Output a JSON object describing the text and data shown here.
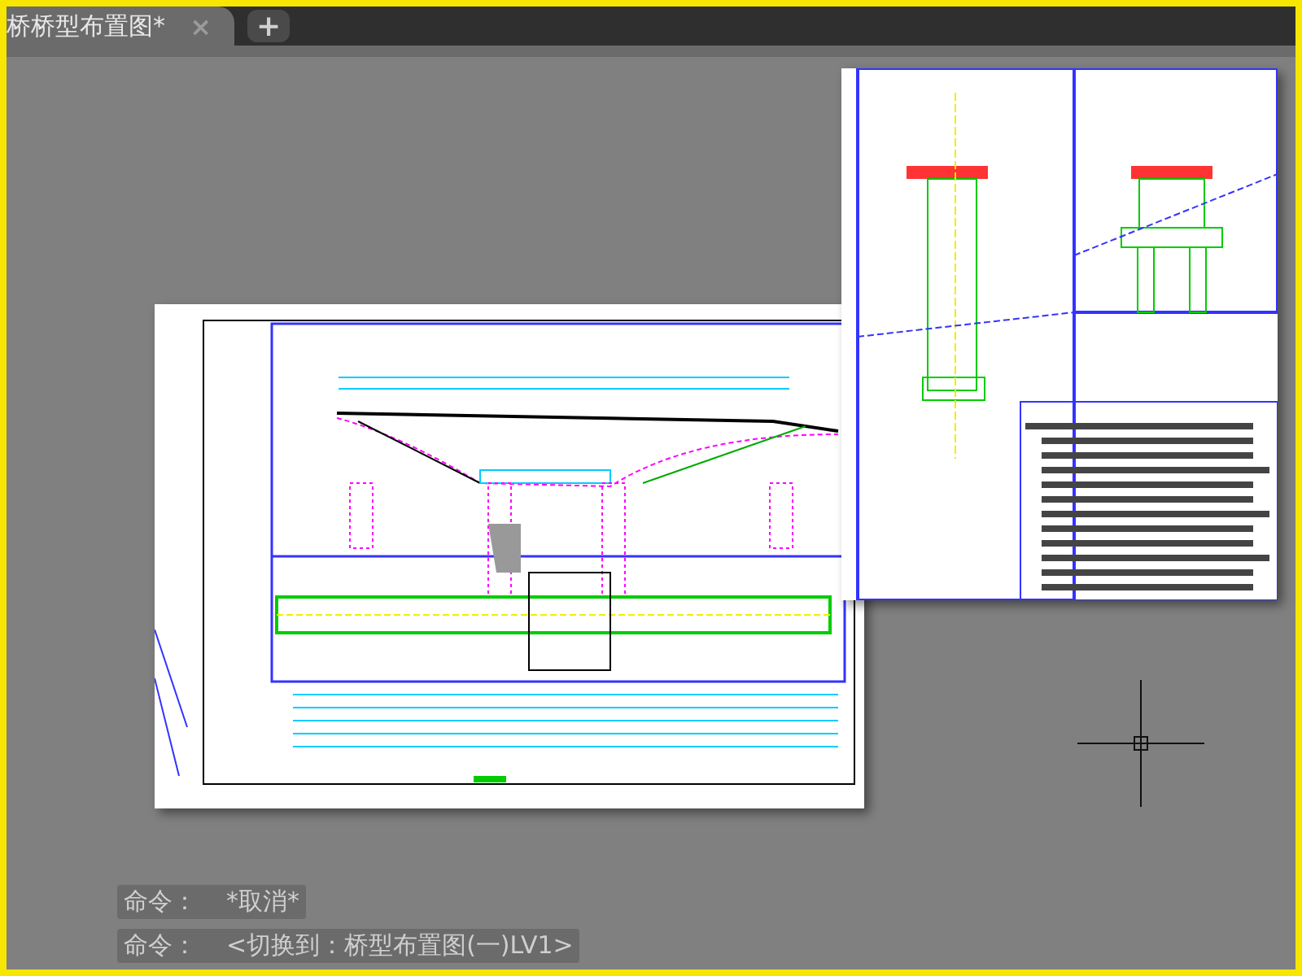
{
  "tabs": [
    {
      "label": "桥桥型布置图*",
      "selected": true,
      "close": "×"
    }
  ],
  "new_tab": "+",
  "command_lines": [
    {
      "prompt": "命令：",
      "message": "*取消*"
    },
    {
      "prompt": "命令：",
      "message": "<切换到：桥型布置图(一)LV1>"
    }
  ]
}
